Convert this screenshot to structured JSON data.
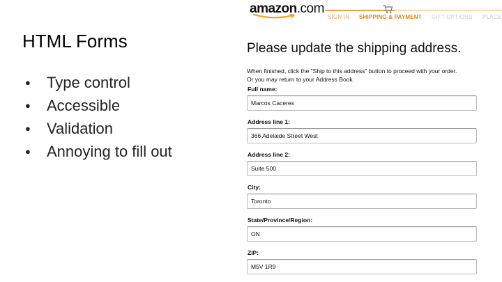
{
  "slide": {
    "title": "HTML Forms",
    "bullets": [
      "Type control",
      "Accessible",
      "Validation",
      "Annoying to fill out"
    ]
  },
  "screenshot": {
    "logo": {
      "brand": "amazon",
      "tld": ".com"
    },
    "steps": {
      "signin": "SIGN IN",
      "shipping": "SHIPPING & PAYMENT",
      "gift": "GIFT OPTIONS",
      "place": "PLACE"
    },
    "heading": "Please update the shipping address.",
    "instructions": [
      "When finished, click the \"Ship to this address\" button to proceed with your order.",
      "Or you may return to your Address Book."
    ],
    "fields": {
      "full_name": {
        "label": "Full name:",
        "value": "Marcos Caceres"
      },
      "address1": {
        "label": "Address line 1:",
        "value": "366 Adelaide Street West"
      },
      "address2": {
        "label": "Address line 2:",
        "value": "Suite 500"
      },
      "city": {
        "label": "City:",
        "value": "Toronto"
      },
      "state": {
        "label": "State/Province/Region:",
        "value": "ON"
      },
      "zip": {
        "label": "ZIP:",
        "value": "M5V 1R9"
      }
    },
    "colors": {
      "accent": "#e8a33a",
      "smile": "#f0a030"
    },
    "icons": {
      "cart": "cart-icon",
      "smile": "amazon-smile-icon"
    }
  }
}
